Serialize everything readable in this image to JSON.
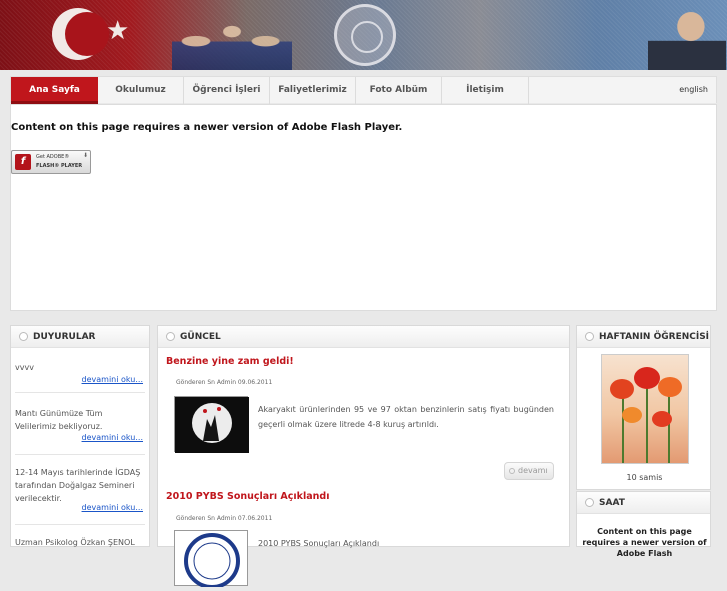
{
  "nav": {
    "tabs": [
      "Ana Sayfa",
      "Okulumuz",
      "Öğrenci İşleri",
      "Faliyetlerimiz",
      "Foto Albüm",
      "İletişim"
    ],
    "active_tab": "Ana Sayfa",
    "language_link": "english"
  },
  "flash": {
    "message": "Content on this page requires a newer version of Adobe Flash Player.",
    "button_line1": "Get ADOBE®",
    "button_line2": "FLASH® PLAYER"
  },
  "duyurular": {
    "title": "DUYURULAR",
    "items": [
      {
        "text": "vvvv",
        "link": "devamini oku..."
      },
      {
        "text": "Mantı Günümüze Tüm Velilerimiz bekliyoruz.",
        "link": "devamini oku..."
      },
      {
        "text": "12-14 Mayıs tarihlerinde İGDAŞ tarafından Doğalgaz Semineri verilecektir.",
        "link": "devamini oku..."
      },
      {
        "text": "Uzman Psikolog Özkan ŞENOL"
      }
    ]
  },
  "guncel": {
    "title": "GÜNCEL",
    "news": [
      {
        "title": "Benzine yine zam geldi!",
        "meta": "Gönderen Sn Admin 09.06.2011",
        "body": "Akaryakıt ürünlerinden 95 ve 97 oktan benzinlerin satış fiyatı bugünden geçerli olmak üzere litrede 4-8 kuruş artırıldı.",
        "button": "devamı"
      },
      {
        "title": "2010 PYBS Sonuçları Açıklandı",
        "meta": "Gönderen Sn Admin 07.06.2011",
        "body": "2010 PYBS Sonuçları Açıklandı"
      }
    ]
  },
  "haftanin": {
    "title": "HAFTANIN ÖĞRENCİSİ",
    "student": "10 samis"
  },
  "saat": {
    "title": "SAAT",
    "message": "Content on this page requires a newer version of Adobe Flash"
  }
}
